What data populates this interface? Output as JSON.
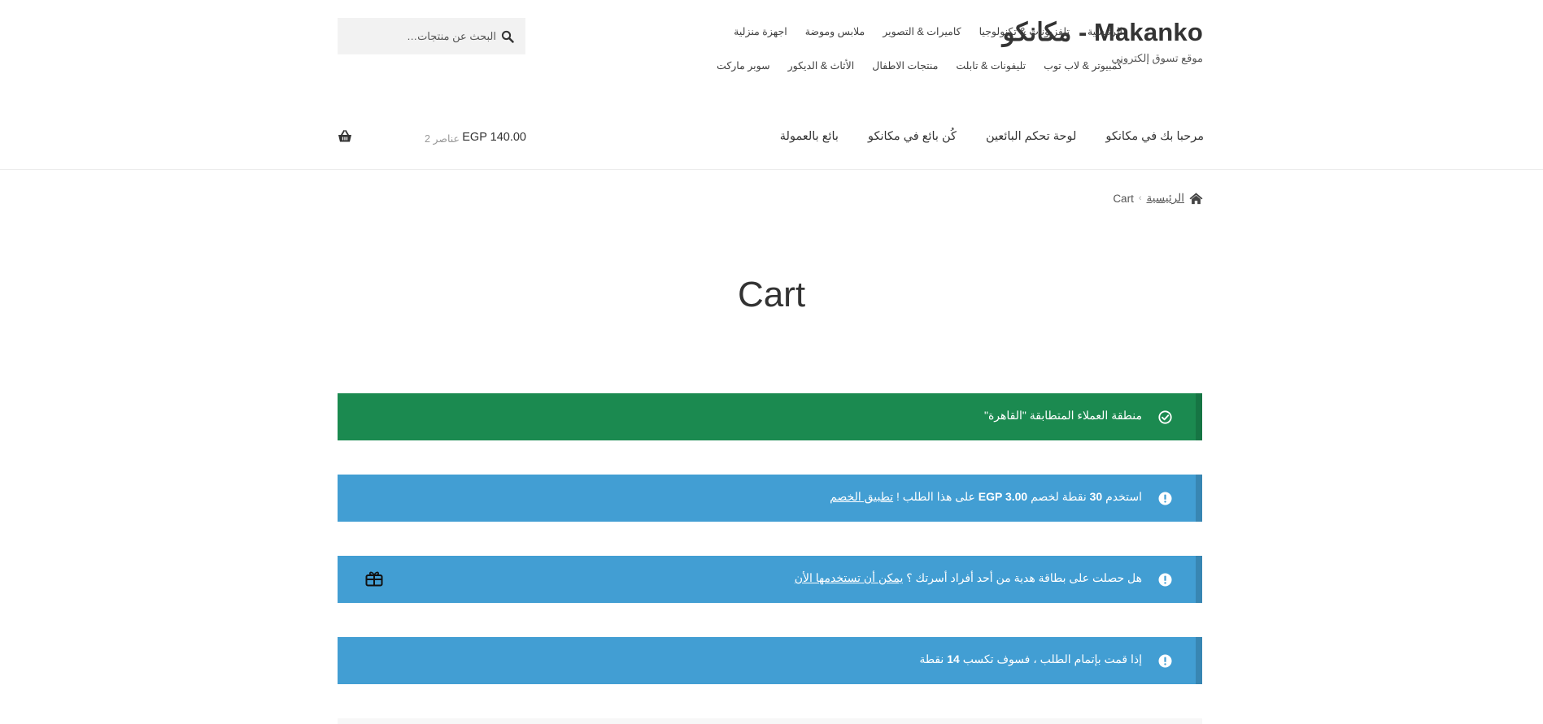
{
  "site": {
    "title": "مكانكو - Makanko",
    "description": "موقع تسوق إلكتروني"
  },
  "main_nav": {
    "row1": [
      "الرئيسية",
      "تلفزيونات & تكنولوجيا",
      "كاميرات & التصوير",
      "ملابس وموضة",
      "اجهزة منزلية"
    ],
    "row2": [
      "كمبيوتر & لاب توب",
      "تليفونات & تابلت",
      "منتجات الاطفال",
      "الأثاث & الديكور",
      "سوبر ماركت"
    ]
  },
  "search": {
    "placeholder": "البحث عن منتجات…"
  },
  "secondary_nav": [
    "مرحبا بك في مكانكو",
    "لوحة تحكم البائعين",
    "كُن بائع في مكانكو",
    "بائع بالعمولة"
  ],
  "cart": {
    "amount": "EGP 140.00",
    "count": "2 عناصر"
  },
  "breadcrumb": {
    "home": "الرئيسية",
    "separator": "›",
    "current": "Cart"
  },
  "page_title": "Cart",
  "notices": {
    "zone": "منطقة العملاء المتطابقة \"القاهرة\"",
    "points": {
      "prefix": "استخدم",
      "points": "30",
      "middle": "نقطة لخصم",
      "amount": "EGP 3.00",
      "suffix": "على هذا الطلب !",
      "link": "تطبيق الخصم"
    },
    "gift": {
      "text": "هل حصلت على بطاقة هدية من أحد أفراد أسرتك ؟",
      "link": "يمكن أن تستخدمها الأن"
    },
    "earn": {
      "prefix": "إذا قمت بإتمام الطلب ، فسوف تكسب",
      "points": "14",
      "suffix": "نقطة"
    }
  },
  "colors": {
    "success": "#1b8a50",
    "info": "#429ed3",
    "text": "#333333"
  },
  "icons": [
    "search-icon",
    "basket-icon",
    "home-icon",
    "check-circle-icon",
    "info-circle-icon",
    "gift-card-icon"
  ]
}
